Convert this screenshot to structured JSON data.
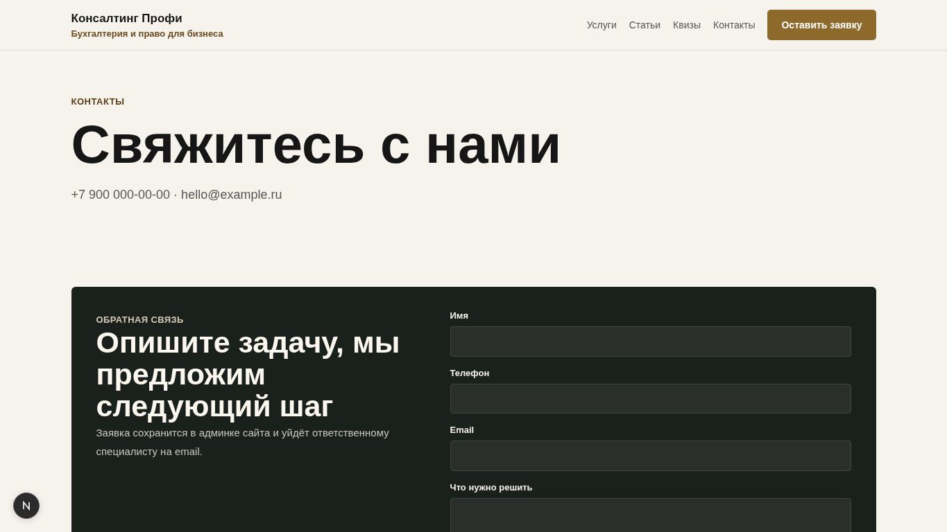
{
  "header": {
    "brand": "Консалтинг Профи",
    "tagline": "Бухгалтерия и право для бизнеса",
    "nav": [
      {
        "label": "Услуги"
      },
      {
        "label": "Статьи"
      },
      {
        "label": "Квизы"
      },
      {
        "label": "Контакты"
      }
    ],
    "cta": "Оставить заявку"
  },
  "hero": {
    "eyebrow": "КОНТАКТЫ",
    "title": "Свяжитесь с нами",
    "contacts": "+7 900 000-00-00 · hello@example.ru"
  },
  "feedback": {
    "eyebrow": "ОБРАТНАЯ СВЯЗЬ",
    "title": "Опишите задачу, мы предложим следующий шаг",
    "note": "Заявка сохранится в админке сайта и уйдёт ответственному специалисту на email.",
    "fields": [
      {
        "label": "Имя",
        "kind": "input"
      },
      {
        "label": "Телефон",
        "kind": "input"
      },
      {
        "label": "Email",
        "kind": "input"
      },
      {
        "label": "Что нужно решить",
        "kind": "textarea"
      }
    ]
  }
}
